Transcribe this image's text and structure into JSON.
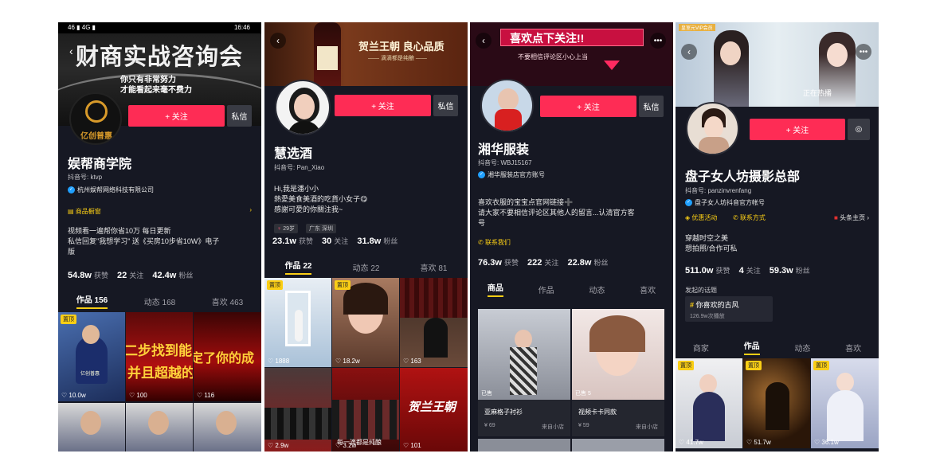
{
  "p1": {
    "status_bar": {
      "signal": "46 ▮ 4G ▮",
      "time": "16:46"
    },
    "banner_title": "财商实战咨询会",
    "banner_line1": "你只有非常努力",
    "banner_line2": "才能看起来毫不费力",
    "avatar_text": "亿创普惠",
    "follow": "+ 关注",
    "message": "私信",
    "name": "娱帮商学院",
    "douyin_id": "抖音号: ktvp",
    "verified": "杭州娱帮网络科技有限公司",
    "shop": "商品橱窗",
    "bio1": "视频看一遍帮你省10万 每日更新",
    "bio2": "私信回复\"我想学习\" 送《买房10步省10W》电子",
    "bio3": "版",
    "likes": "54.8w",
    "likes_label": "获赞",
    "following": "22",
    "following_label": "关注",
    "fans": "42.4w",
    "fans_label": "粉丝",
    "tabs": [
      "作品 156",
      "动态 168",
      "喜欢 463"
    ],
    "pin": "置顶",
    "tile1_likes": "10.0w",
    "tile2_likes": "100",
    "tile3_likes": "116",
    "tile2_text": "二步找到能",
    "tile2_text2": "并且超越的",
    "tile3_text": "定了你的成",
    "tile1_caption": "亿创普惠"
  },
  "p2": {
    "banner_title": "贺兰王朝  良心品质",
    "banner_sub": "—— 滴滴都是纯酿 ——",
    "follow": "+ 关注",
    "message": "私信",
    "name": "慧选酒",
    "douyin_id": "抖音号: Pan_Xiao",
    "bio1": "Hi,我是潘小小",
    "bio2": "熱愛美食美酒的吃貨小女子😋",
    "bio3": "感謝可愛的你關注我~",
    "age": "29岁",
    "region": "广东 深圳",
    "likes": "23.1w",
    "likes_label": "获赞",
    "following": "30",
    "following_label": "关注",
    "fans": "31.8w",
    "fans_label": "粉丝",
    "tabs": [
      "作品 22",
      "动态 22",
      "喜欢 81"
    ],
    "pin": "置顶",
    "tile1_likes": "1888",
    "tile2_likes": "18.2w",
    "tile3_likes": "163",
    "tile4_likes": "2.9w",
    "tile5_likes": "3.2w",
    "tile6_likes": "101",
    "tile4_text": "每一滴都是纯酿",
    "tile6_text": "贺兰王朝"
  },
  "p3": {
    "banner_title": "喜欢点下关注!!",
    "banner_sub": "不要相信评论区小心上当",
    "follow": "+ 关注",
    "message": "私信",
    "name": "湘华服装",
    "douyin_id": "抖音号: WBJ15167",
    "verified": "湘华服装店官方账号",
    "bio1": "喜欢衣服的宝宝点官网链接➕",
    "bio2": "请大家不要相信评论区其他人的留言...认清官方客",
    "bio3": "号",
    "contact": "联系我们",
    "likes": "76.3w",
    "likes_label": "获赞",
    "following": "222",
    "following_label": "关注",
    "fans": "22.8w",
    "fans_label": "粉丝",
    "tabs": [
      "商品",
      "作品",
      "动态",
      "喜欢"
    ],
    "item1": {
      "sold": "已售",
      "title": "亚麻格子衬衫",
      "price": "¥ 69",
      "source": "来自小店"
    },
    "item2": {
      "sold": "已售 5",
      "title": "视频卡卡同款",
      "price": "¥ 59",
      "source": "来自小店"
    }
  },
  "p4": {
    "banner_badge": "皇室元VIP会员",
    "banner_sub": "正在热播",
    "follow": "+ 关注",
    "name": "盘子女人坊摄影总部",
    "douyin_id": "抖音号: panzinvrenfang",
    "verified": "盘子女人坊抖音官方帐号",
    "promo": "优惠活动",
    "contact": "联系方式",
    "toutiao": "头条主页",
    "bio1": "穿越时空之美",
    "bio2": "想拍照/合作可私",
    "likes": "511.0w",
    "likes_label": "获赞",
    "following": "4",
    "following_label": "关注",
    "fans": "59.3w",
    "fans_label": "粉丝",
    "topic_header": "发起的话题",
    "topic": "你喜欢的古风",
    "topic_plays": "126.9w次播放",
    "tabs": [
      "商家",
      "作品",
      "动态",
      "喜欢"
    ],
    "pin": "置顶",
    "tile1_likes": "41.7w",
    "tile2_likes": "51.7w",
    "tile3_likes": "36.1w"
  },
  "colors": {
    "accent": "#fe2c55",
    "pin": "#face15",
    "bg": "#161823"
  }
}
